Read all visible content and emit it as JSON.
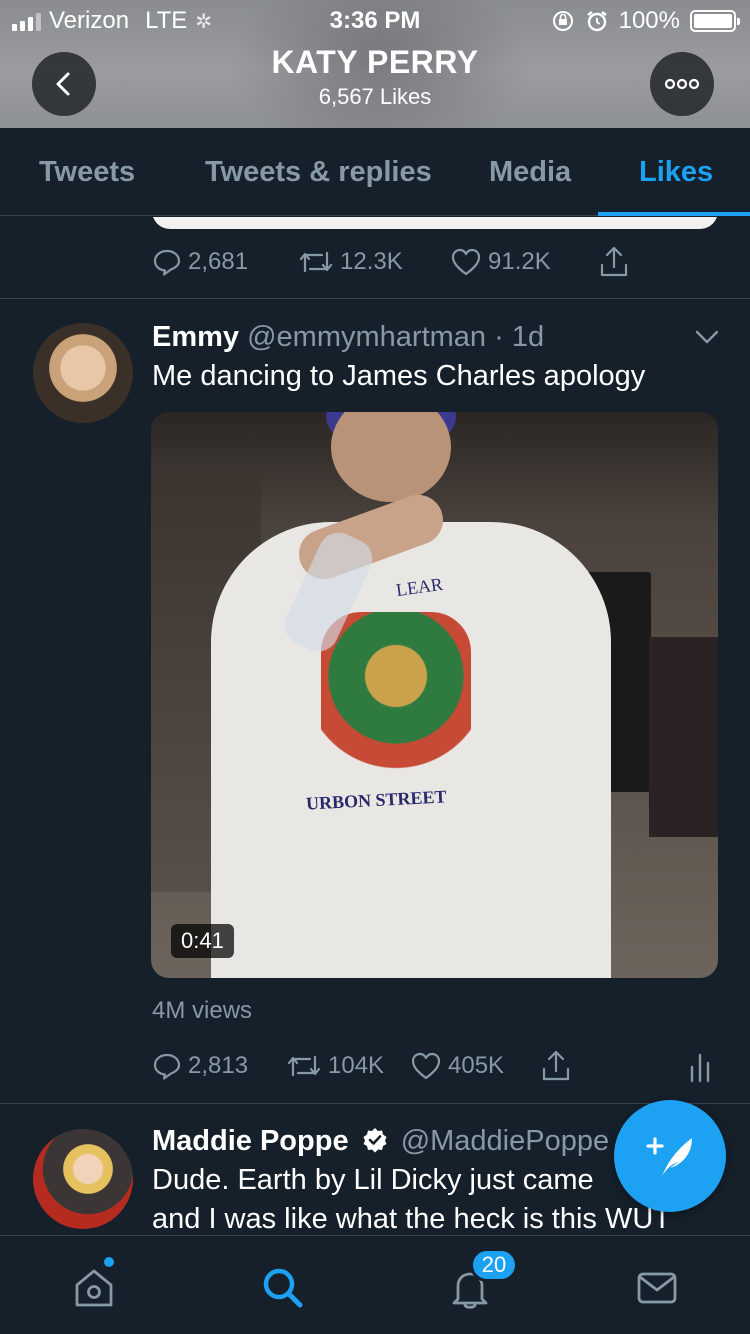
{
  "status_bar": {
    "carrier": "Verizon",
    "network": "LTE",
    "time": "3:36 PM",
    "battery": "100%"
  },
  "header": {
    "title": "KATY PERRY",
    "subtitle": "6,567 Likes"
  },
  "tabs": [
    {
      "label": "Tweets",
      "active": false
    },
    {
      "label": "Tweets & replies",
      "active": false
    },
    {
      "label": "Media",
      "active": false
    },
    {
      "label": "Likes",
      "active": true
    }
  ],
  "previous_tweet": {
    "replies": "2,681",
    "retweets": "12.3K",
    "likes": "91.2K"
  },
  "tweet_emmy": {
    "name": "Emmy",
    "handle": "@emmymhartman",
    "time": "· 1d",
    "text": "Me dancing to James Charles apology",
    "video_duration": "0:41",
    "video_overlay_text_1": "LEAR",
    "video_overlay_text_2": "URBON STREET",
    "views": "4M views",
    "replies": "2,813",
    "retweets": "104K",
    "likes": "405K"
  },
  "tweet_maddie": {
    "name": "Maddie Poppe",
    "handle": "@MaddiePoppe",
    "verified": true,
    "text_line1": "Dude. Earth by Lil Dicky just came",
    "text_line2": "and I was like what the heck is this WUT"
  },
  "bottom_nav": {
    "notifications_badge": "20"
  },
  "colors": {
    "background": "#15202b",
    "accent": "#1da1f2",
    "muted": "#8899a6",
    "divider": "#38444d"
  }
}
